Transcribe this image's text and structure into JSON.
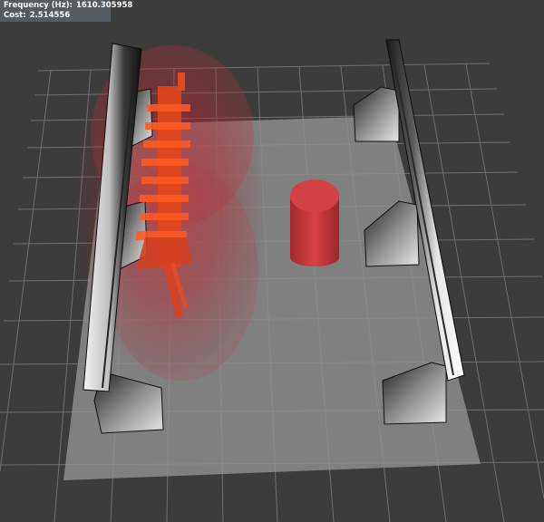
{
  "overlay": {
    "frequency_label": "Frequency (Hz):",
    "frequency_value": "1610.305958",
    "cost_label": "Cost:",
    "cost_value": "2.514556"
  },
  "colors": {
    "background": "#3c3c3c",
    "grid_line": "#6e6e6e",
    "floor_plate": "#8e8e8e",
    "rail_light": "#f2f2f2",
    "rail_dark": "#1e1e1e",
    "robot_red": "#e0401c",
    "obstacle_red": "#c8383a",
    "overlay_bg": "#5a6068"
  },
  "scene_objects": {
    "rails": 2,
    "rail_support_brackets": 6,
    "robot_arm_swept_poses": "multiple semi-transparent red",
    "obstacle": "red cylinder"
  }
}
